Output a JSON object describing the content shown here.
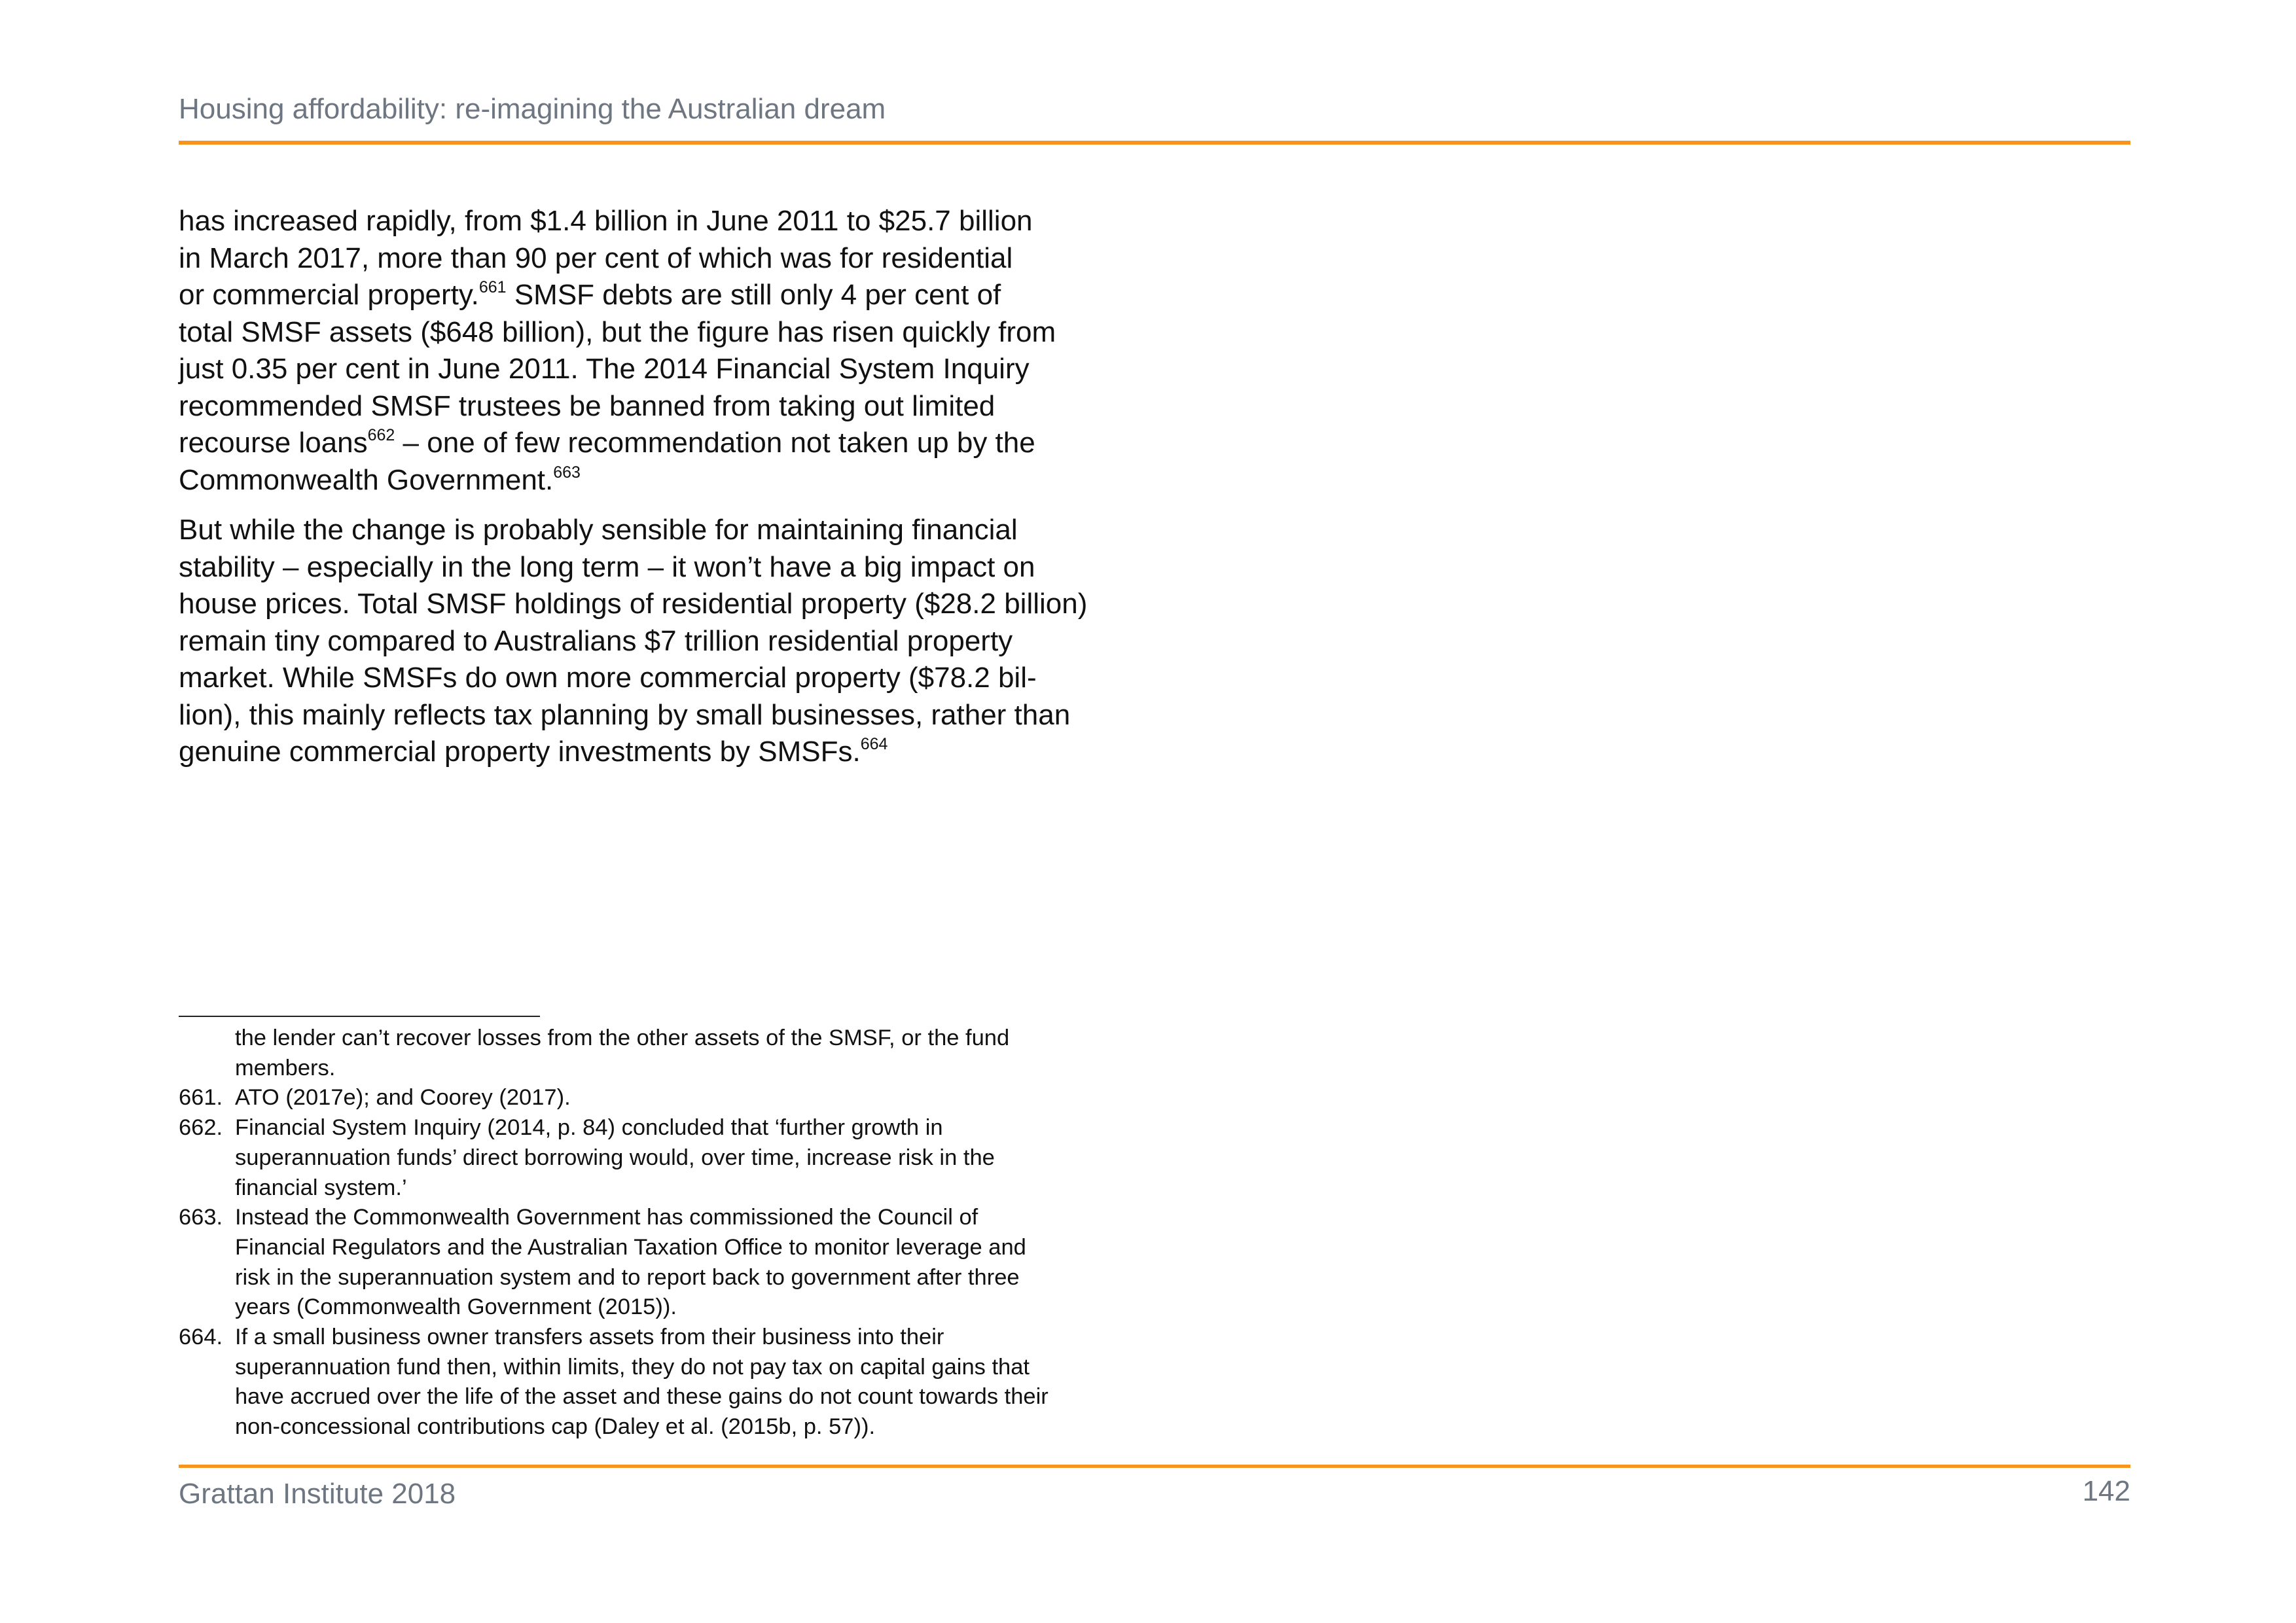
{
  "header": {
    "title": "Housing affordability: re-imagining the Australian dream"
  },
  "body": {
    "paragraph1": {
      "l1": "has increased rapidly, from $1.4 billion in June 2011 to $25.7 billion",
      "l2": "in March 2017, more than 90 per cent of which was for residential",
      "l3a": "or commercial property.",
      "ref661": "661",
      "l3b": " SMSF debts are still only 4 per cent of",
      "l4": "total SMSF assets ($648 billion), but the figure has risen quickly from",
      "l5": "just 0.35 per cent in June 2011. The 2014 Financial System Inquiry",
      "l6": "recommended SMSF trustees be banned from taking out limited",
      "l7a": "recourse loans",
      "ref662": "662",
      "l7b": " – one of few recommendation not taken up by the",
      "l8a": "Commonwealth Government.",
      "ref663": "663"
    },
    "paragraph2": {
      "l1": "But while the change is probably sensible for maintaining financial",
      "l2": "stability – especially in the long term – it won’t have a big impact on",
      "l3": "house prices. Total SMSF holdings of residential property ($28.2 billion)",
      "l4": "remain tiny compared to Australians $7 trillion residential property",
      "l5": "market. While SMSFs do own more commercial property ($78.2 bil-",
      "l6": "lion), this mainly reflects tax planning by small businesses, rather than",
      "l7a": "genuine commercial property investments by SMSFs.",
      "ref664": "664"
    }
  },
  "footnotes": {
    "continued": {
      "l1": "the lender can’t recover losses from the other assets of the SMSF, or the fund",
      "l2": "members."
    },
    "fn661": {
      "num": "661.",
      "l1": "ATO (2017e);  and Coorey (2017)."
    },
    "fn662": {
      "num": "662.",
      "l1": "Financial System Inquiry (2014, p. 84) concluded that ‘further growth in",
      "l2": "superannuation funds’ direct borrowing would, over time, increase risk in the",
      "l3": "financial system.’"
    },
    "fn663": {
      "num": "663.",
      "l1": "Instead the Commonwealth Government has commissioned the Council of",
      "l2": "Financial Regulators and the Australian Taxation Office to monitor leverage and",
      "l3": "risk in the superannuation system and to report back to government after three",
      "l4": "years (Commonwealth Government (2015))."
    },
    "fn664": {
      "num": "664.",
      "l1": "If a small business owner transfers assets from their business into their",
      "l2": "superannuation fund then, within limits, they do not pay tax on capital gains that",
      "l3": "have accrued over the life of the asset and these gains do not count towards their",
      "l4": "non-concessional contributions cap (Daley et al. (2015b, p. 57))."
    }
  },
  "footer": {
    "left": "Grattan Institute 2018",
    "page_number": "142"
  },
  "colors": {
    "accent_rule": "#f7941d",
    "header_text": "#6d7681",
    "body_text": "#111111"
  }
}
